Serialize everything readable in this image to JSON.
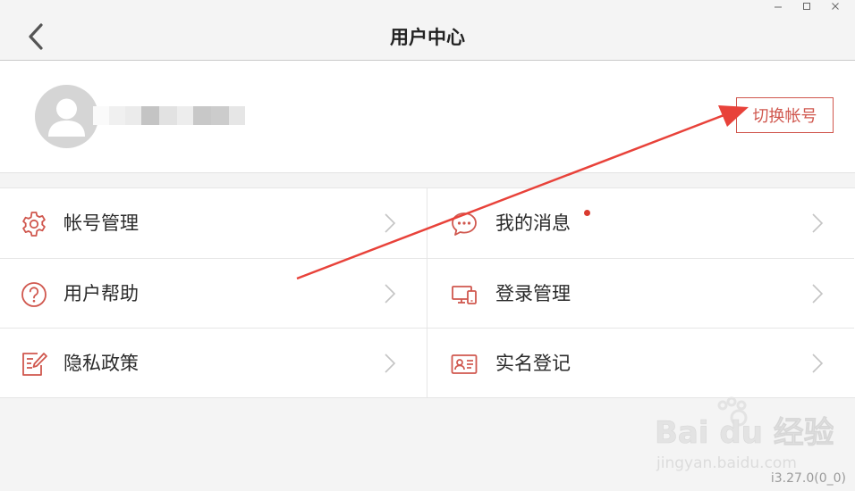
{
  "window": {
    "controls": [
      {
        "name": "minimize-icon"
      },
      {
        "name": "maximize-icon"
      },
      {
        "name": "close-icon"
      }
    ]
  },
  "header": {
    "title": "用户中心",
    "back_icon": "chevron-left-icon"
  },
  "profile": {
    "avatar_icon": "user-avatar-icon",
    "switch_account_label": "切换帐号",
    "accent_color": "#d0574e"
  },
  "menu": [
    {
      "label": "帐号管理",
      "icon": "gear-icon"
    },
    {
      "label": "我的消息",
      "icon": "chat-bubble-icon",
      "unread": true
    },
    {
      "label": "用户帮助",
      "icon": "question-circle-icon"
    },
    {
      "label": "登录管理",
      "icon": "devices-icon"
    },
    {
      "label": "隐私政策",
      "icon": "policy-edit-icon"
    },
    {
      "label": "实名登记",
      "icon": "id-card-icon"
    }
  ],
  "watermark": {
    "brand": "Bai du 经验",
    "url": "jingyan.baidu.com"
  },
  "version": "i3.27.0(0_0)",
  "colors": {
    "accent": "#d0574e",
    "unread_dot": "#d93a2f",
    "annotation_arrow": "#e8423a"
  }
}
